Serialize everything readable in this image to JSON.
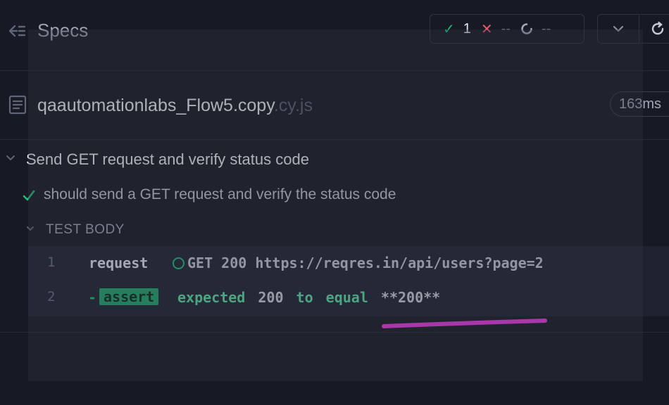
{
  "header": {
    "title": "Specs",
    "stats": {
      "passed": "1",
      "failed": "--",
      "pending": "--"
    }
  },
  "spec": {
    "file_name": "qaautomationlabs_Flow5.copy",
    "file_ext": ".cy.js",
    "duration": "163ms"
  },
  "suite": {
    "title": "Send GET request and verify status code"
  },
  "test": {
    "title": "should send a GET request and verify the status code",
    "section_label": "TEST BODY"
  },
  "commands": [
    {
      "number": "1",
      "method": "request",
      "message": "GET 200 https://reqres.in/api/users?page=2"
    },
    {
      "number": "2",
      "prefix": "-",
      "method": "assert",
      "message_parts": [
        "expected",
        "200",
        "to equal",
        "**200**"
      ]
    }
  ],
  "colors": {
    "pass": "#1fbf7a",
    "fail": "#ef5a6f",
    "annotation": "#e83ae0"
  },
  "icons": {
    "back": "back-arrow-icon",
    "passed": "check-icon",
    "failed": "x-icon",
    "pending": "spinner-icon",
    "dropdown": "chevron-down-icon",
    "refresh": "refresh-icon",
    "file": "document-icon"
  }
}
